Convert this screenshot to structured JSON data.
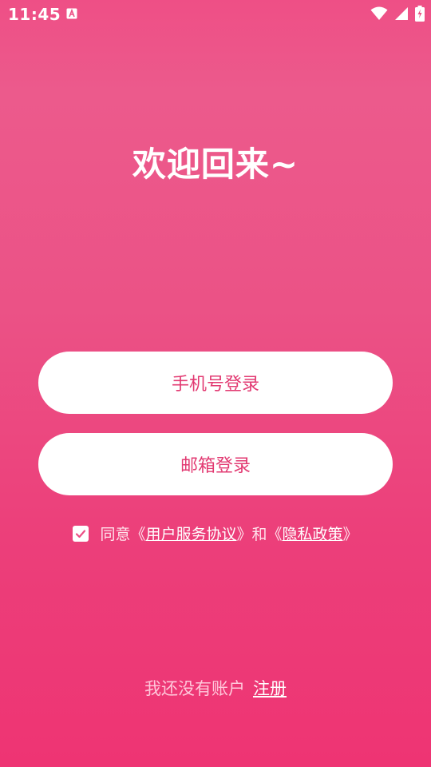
{
  "status_bar": {
    "time": "11:45",
    "icons": [
      "a-notification-icon",
      "wifi-icon",
      "signal-icon",
      "battery-charging-icon"
    ]
  },
  "welcome": {
    "title": "欢迎回来~"
  },
  "buttons": {
    "phone_login": "手机号登录",
    "email_login": "邮箱登录"
  },
  "agreement": {
    "checked": true,
    "prefix": "同意《",
    "user_agreement": "用户服务协议",
    "middle": "》和《",
    "privacy_policy": "隐私政策",
    "suffix": "》"
  },
  "register": {
    "prompt": "我还没有账户",
    "link": "注册"
  },
  "colors": {
    "background": "#ec4f85",
    "button_text": "#e23a72",
    "button_bg": "#ffffff"
  }
}
